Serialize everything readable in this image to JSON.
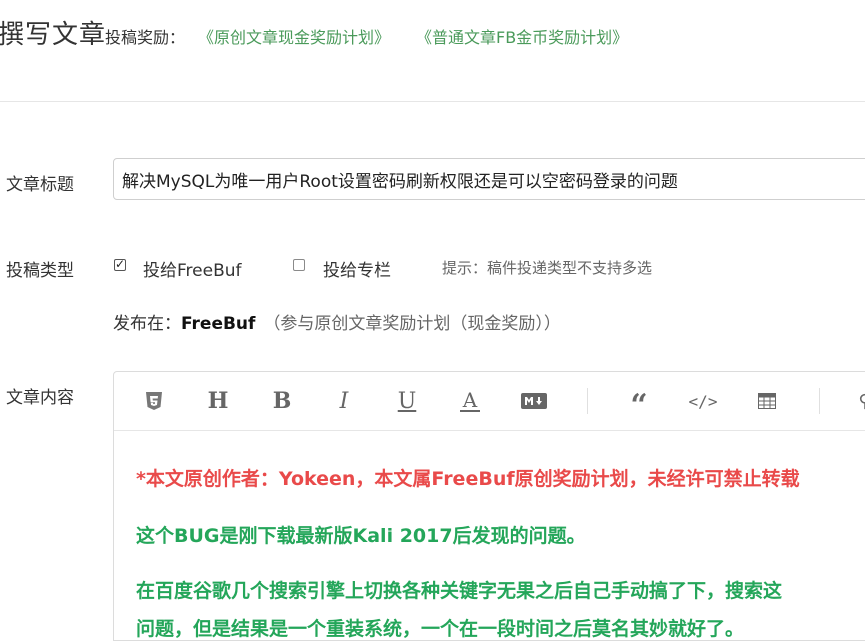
{
  "header": {
    "title": "撰写文章",
    "reward_label": "投稿奖励：",
    "reward_links": [
      "《原创文章现金奖励计划》",
      "《普通文章FB金币奖励计划》"
    ]
  },
  "form": {
    "title_label": "文章标题",
    "title_value": "解决MySQL为唯一用户Root设置密码刷新权限还是可以空密码登录的问题",
    "type_label": "投稿类型",
    "options": [
      {
        "label": "投给FreeBuf",
        "checked": true
      },
      {
        "label": "投给专栏",
        "checked": false
      }
    ],
    "type_hint": "提示：稿件投递类型不支持多选",
    "publish_prefix": "发布在：",
    "publish_target": "FreeBuf",
    "publish_note": "（参与原创文章奖励计划（现金奖励））",
    "content_label": "文章内容"
  },
  "editor": {
    "toolbar_icons": [
      "html5-icon",
      "heading-icon",
      "bold-icon",
      "italic-icon",
      "underline-icon",
      "font-color-icon",
      "markdown-icon",
      "quote-icon",
      "code-icon",
      "table-icon"
    ],
    "paragraphs": [
      "*本文原创作者：Yokeen，本文属FreeBuf原创奖励计划，未经许可禁止转载",
      "这个BUG是刚下载最新版Kali 2017后发现的问题。",
      "在百度谷歌几个搜索引擎上切换各种关键字无果之后自己手动搞了下，搜索这",
      "问题，但是结果是一个重装系统，一个在一段时间之后莫名其妙就好了。"
    ],
    "colors": {
      "red": "#e94a4a",
      "green": "#24a65a"
    }
  }
}
